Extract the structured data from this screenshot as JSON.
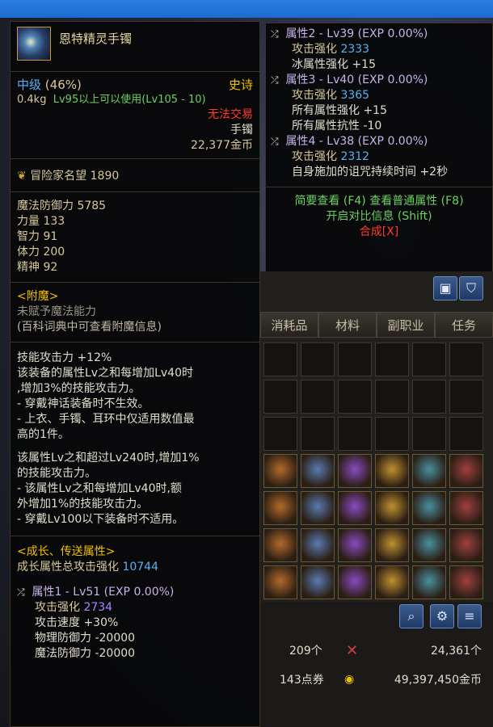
{
  "colors": {
    "accent_gold": "#f0c000",
    "green": "#6bd060",
    "red": "#ff3a2a",
    "blue": "#5ab0f0",
    "purple": "#b080ff"
  },
  "item": {
    "name": "恩特精灵手镯",
    "grade": "中级",
    "grade_pct": "(46%)",
    "rarity": "史诗",
    "weight": "0.4kg",
    "level_req": "Lv95以上可以使用(Lv105 - 10)",
    "trade": "无法交易",
    "slot": "手镯",
    "price": "22,377金币"
  },
  "fame": {
    "label": "冒险家名望",
    "value": "1890"
  },
  "stats": [
    {
      "label": "魔法防御力",
      "value": "5785"
    },
    {
      "label": "力量",
      "value": "133"
    },
    {
      "label": "智力",
      "value": "91"
    },
    {
      "label": "体力",
      "value": "200"
    },
    {
      "label": "精神",
      "value": "92"
    }
  ],
  "enchant": {
    "title": "<附魔>",
    "line1": "未赋予魔法能力",
    "line2": "(百科词典中可查看附魔信息)"
  },
  "effect1": [
    "技能攻击力 +12%",
    "该装备的属性Lv之和每增加Lv40时",
    ",增加3%的技能攻击力。",
    "- 穿戴神话装备时不生效。",
    "- 上衣、手镯、耳环中仅适用数值最",
    "高的1件。"
  ],
  "effect2": [
    "该属性Lv之和超过Lv240时,增加1%",
    "的技能攻击力。",
    "- 该属性Lv之和每增加Lv40时,额",
    "外增加1%的技能攻击力。",
    "- 穿戴Lv100以下装备时不适用。"
  ],
  "growth": {
    "title": "<成长、传送属性>",
    "total_label": "成长属性总攻击强化",
    "total_value": "10744",
    "prop1": {
      "header": "属性1 - Lv51 (EXP 0.00%)",
      "atk_label": "攻击强化",
      "atk_value": "2734",
      "lines": [
        "攻击速度 +30%",
        "物理防御力 -20000",
        "魔法防御力 -20000"
      ]
    }
  },
  "right": {
    "prop2": {
      "header": "属性2 - Lv39 (EXP 0.00%)",
      "atk_label": "攻击强化",
      "atk_value": "2333",
      "lines": [
        "冰属性强化 +15"
      ]
    },
    "prop3": {
      "header": "属性3 - Lv40 (EXP 0.00%)",
      "atk_label": "攻击强化",
      "atk_value": "3365",
      "lines": [
        "所有属性强化 +15",
        "所有属性抗性 -10"
      ]
    },
    "prop4": {
      "header": "属性4 - Lv38 (EXP 0.00%)",
      "atk_label": "攻击强化",
      "atk_value": "2312",
      "lines": [
        "自身施加的诅咒持续时间 +2秒"
      ]
    },
    "hint1": "简要查看 (F4) 查看普通属性 (F8)",
    "hint2": "开启对比信息 (Shift)",
    "hint3": "合成[X]"
  },
  "inventory": {
    "tabs": [
      "消耗品",
      "材料",
      "副职业",
      "任务"
    ],
    "count": "209个",
    "amount2": "24,361个",
    "coupons": "143点券",
    "gold": "49,397,450金币"
  }
}
